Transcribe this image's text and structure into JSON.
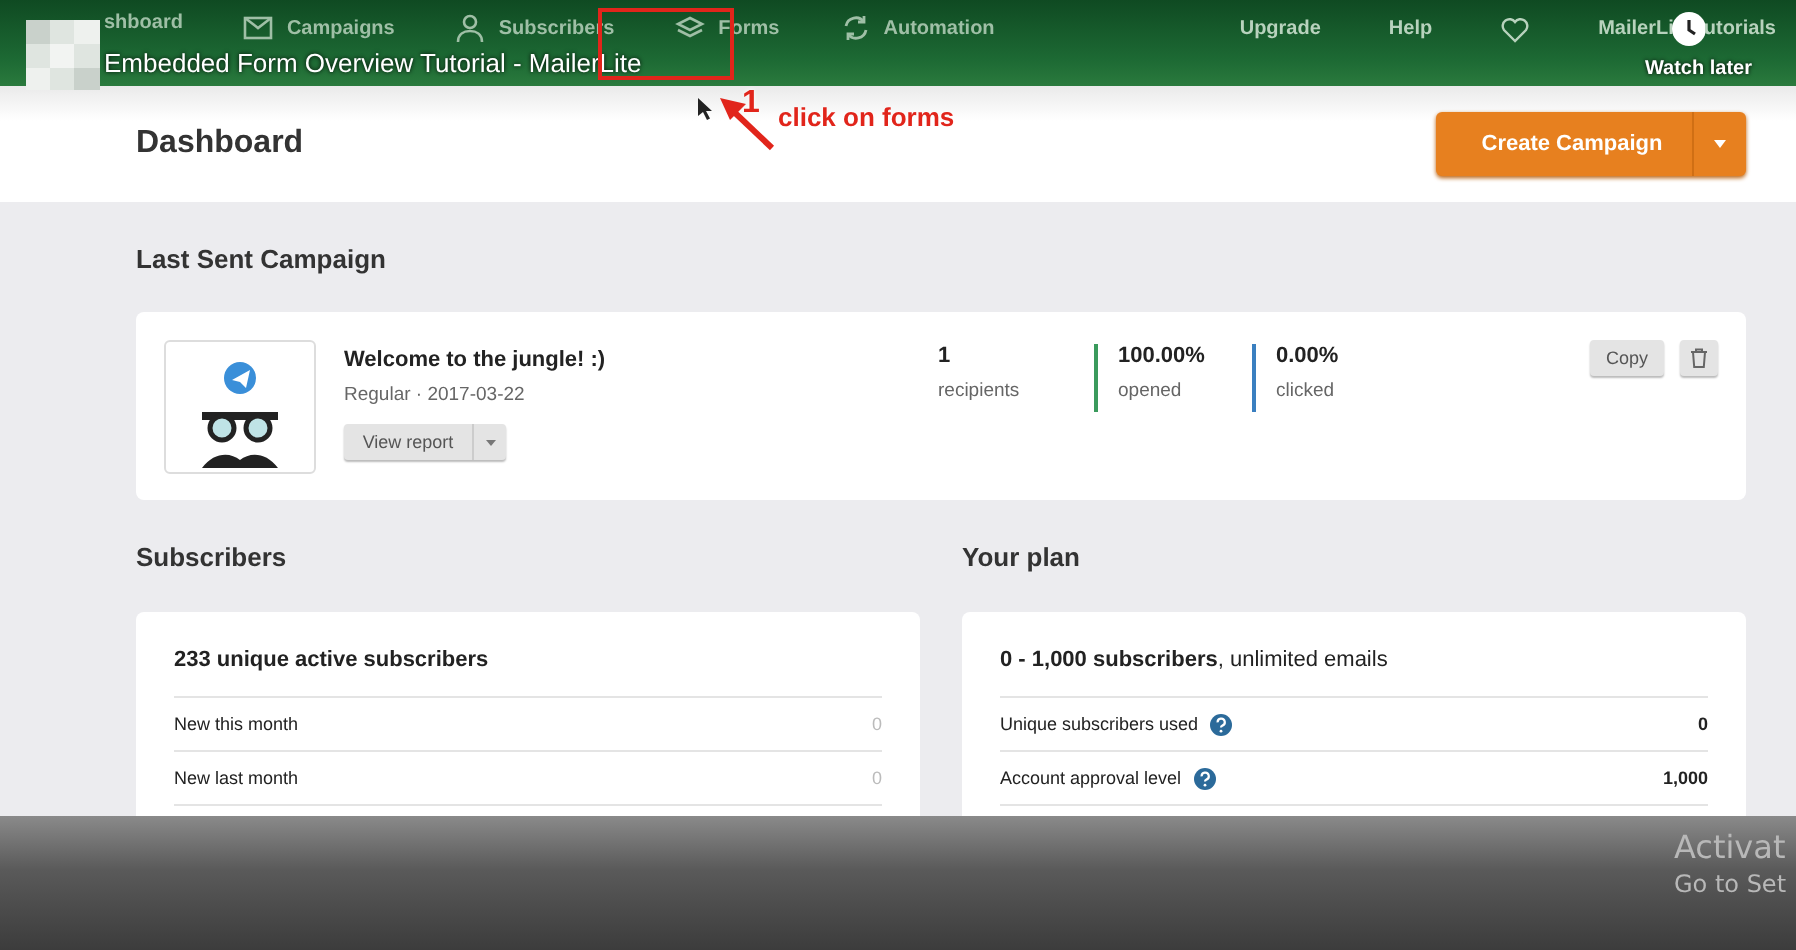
{
  "video_overlay": {
    "title": "Embedded Form Overview Tutorial - MailerLite",
    "watch_later": "Watch later"
  },
  "nav": {
    "items": [
      {
        "label": "shboard"
      },
      {
        "label": "Campaigns"
      },
      {
        "label": "Subscribers"
      },
      {
        "label": "Forms"
      },
      {
        "label": "Automation"
      }
    ],
    "links": [
      "Upgrade",
      "Help"
    ],
    "account": [
      "MailerLi",
      "utorials"
    ]
  },
  "annotation": {
    "number": "1",
    "text": "click on forms"
  },
  "header": {
    "title": "Dashboard",
    "button": "Create Campaign"
  },
  "last_campaign": {
    "heading": "Last Sent Campaign",
    "name": "Welcome to the jungle! :)",
    "meta": "Regular · 2017-03-22",
    "report_button": "View report",
    "copy_button": "Copy",
    "stats": [
      {
        "value": "1",
        "label": "recipients"
      },
      {
        "value": "100.00%",
        "label": "opened",
        "color": "#3a9a5c"
      },
      {
        "value": "0.00%",
        "label": "clicked",
        "color": "#3a7fc0"
      }
    ]
  },
  "subscribers": {
    "heading": "Subscribers",
    "summary": "233 unique active subscribers",
    "rows": [
      {
        "label": "New this month",
        "value": "0",
        "help": false
      },
      {
        "label": "New last month",
        "value": "0",
        "help": false
      }
    ]
  },
  "plan": {
    "heading": "Your plan",
    "summary": "**0 - 1,000 subscribers**, unlimited emails",
    "rows": [
      {
        "label": "Unique subscribers used",
        "value": "0",
        "help": true
      },
      {
        "label": "Account approval level",
        "value": "1,000",
        "help": true
      }
    ]
  },
  "os_notice": [
    "Activat",
    "Go to Set"
  ]
}
